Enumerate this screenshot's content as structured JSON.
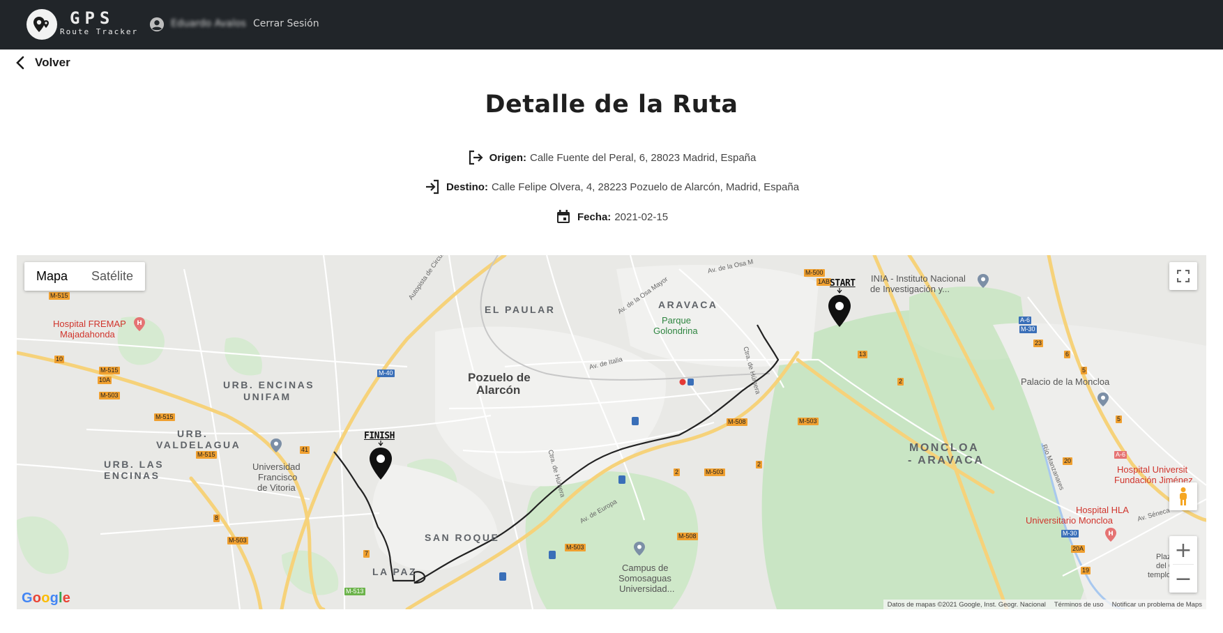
{
  "header": {
    "brand_title": "GPS",
    "brand_subtitle": "Route Tracker",
    "user_name": "Eduardo Avalos",
    "logout_label": "Cerrar Sesión"
  },
  "nav": {
    "back_label": "Volver"
  },
  "page": {
    "title": "Detalle de la Ruta"
  },
  "route": {
    "origin_label": "Origen:",
    "origin_value": "Calle Fuente del Peral, 6, 28023 Madrid, España",
    "destination_label": "Destino:",
    "destination_value": "Calle Felipe Olvera, 4, 28223 Pozuelo de Alarcón, Madrid, España",
    "date_label": "Fecha:",
    "date_value": "2021-02-15"
  },
  "map": {
    "type_map": "Mapa",
    "type_satellite": "Satélite",
    "start_label": "START",
    "finish_label": "FINISH",
    "google_logo": "Google",
    "attribution": "Datos de mapas ©2021 Google, Inst. Geogr. Nacional",
    "terms": "Términos de uso",
    "report": "Notificar un problema de Maps",
    "zoom_in": "+",
    "zoom_out": "−",
    "labels": {
      "el_paular": "EL PAULAR",
      "aravaca": "ARAVACA",
      "pozuelo_1": "Pozuelo de",
      "pozuelo_2": "Alarcón",
      "encinas_unifam_1": "URB. ENCINAS",
      "encinas_unifam_2": "UNIFAM",
      "valdelagua_1": "URB.",
      "valdelagua_2": "VALDELAGUA",
      "las_encinas_1": "URB. LAS",
      "las_encinas_2": "ENCINAS",
      "san_roque": "SAN ROQUE",
      "la_paz": "LA PAZ",
      "moncloa_1": "MONCLOA",
      "moncloa_2": "- ARAVACA",
      "hospital_fremap_1": "Hospital FREMAP",
      "hospital_fremap_2": "Majadahonda",
      "univ_fv_1": "Universidad",
      "univ_fv_2": "Francisco",
      "univ_fv_3": "de Vitoria",
      "parque_1": "Parque",
      "parque_2": "Golondrina",
      "inia_1": "INIA - Instituto Nacional",
      "inia_2": "de Investigación y...",
      "palacio": "Palacio de la Moncloa",
      "campus_1": "Campus de",
      "campus_2": "Somosaguas",
      "campus_3": "Universidad...",
      "hosp_univ_1": "Hospital Universit",
      "hosp_univ_2": "Fundación Jiménez",
      "hosp_hla_1": "Hospital HLA",
      "hosp_hla_2": "Universitario Moncloa",
      "autopista": "Autopista de Circunvalación",
      "av_osa_mayor": "Av. de la Osa Mayor",
      "av_osa": "Av. de la Osa M",
      "av_italia": "Av. de Italia",
      "ctra_humera": "Ctra. de Húmera",
      "ctra_humera2": "Ctra. de Húmera",
      "av_europa": "Av. de Europa",
      "rio_manzanares": "Río Manzanares",
      "av_seneca": "Av. Séneca",
      "plaza": "Plaza",
      "del_c": "del C",
      "templo": "templo"
    },
    "shields": {
      "m515a": "M-515",
      "m515b": "M-515",
      "m515c": "M-515",
      "m515d": "M-515",
      "m503a": "M-503",
      "m503b": "M-503",
      "m503c": "M-503",
      "m503d": "M-503",
      "m503e": "M-503",
      "m508a": "M-508",
      "m508b": "M-508",
      "m500": "M-500",
      "m40": "M-40",
      "m513": "M-513",
      "a6a": "A-6",
      "a6b": "A-6",
      "m30a": "M-30",
      "m30b": "M-30",
      "x10": "10",
      "x10a": "10A",
      "x8": "8",
      "x7": "7",
      "x41": "41",
      "x23": "23",
      "x6": "6",
      "x5a": "5",
      "x5b": "5",
      "x20": "20",
      "x20a": "20A",
      "x19": "19",
      "x2a": "2",
      "x2b": "2",
      "x2c": "2",
      "x1ab": "1AB",
      "x13": "13"
    }
  }
}
